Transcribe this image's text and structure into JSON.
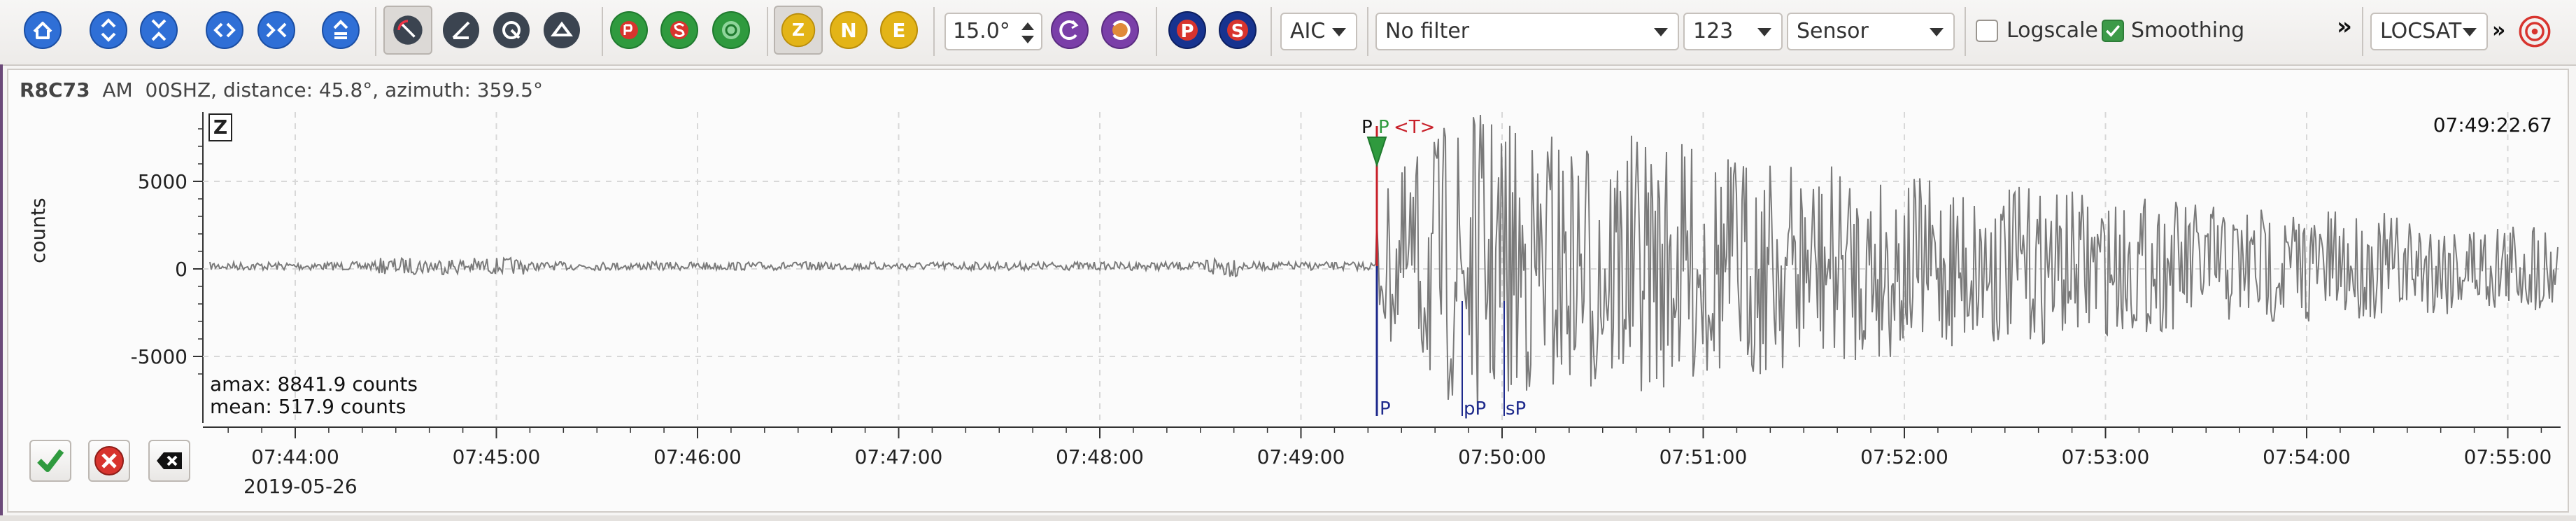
{
  "toolbar": {
    "filter_method": "AIC",
    "angle_value": "15.0°",
    "filter": "No filter",
    "numeric_combo": "123",
    "sensor_combo": "Sensor",
    "logscale_label": "Logscale",
    "logscale_checked": false,
    "smoothing_label": "Smoothing",
    "smoothing_checked": true,
    "overflow_label": "»",
    "locator": "LOCSAT",
    "locator_overflow": "»",
    "components": [
      "Z",
      "N",
      "E"
    ],
    "phase_buttons": [
      "P",
      "S"
    ]
  },
  "trace": {
    "station": "R8C73",
    "network": "AM",
    "channel": "00SHZ",
    "distance_text": "distance: 45.8°",
    "azimuth_text": "azimuth: 359.5°",
    "component": "Z",
    "ylabel": "counts",
    "amax": "amax: 8841.9 counts",
    "mean": "mean: 517.9 counts",
    "time_corner": "07:49:22.67",
    "date": "2019-05-26",
    "y_ticks": [
      "5000",
      "0",
      "-5000"
    ],
    "x_ticks": [
      "07:44:00",
      "07:45:00",
      "07:46:00",
      "07:47:00",
      "07:48:00",
      "07:49:00",
      "07:50:00",
      "07:51:00",
      "07:52:00",
      "07:53:00",
      "07:54:00",
      "07:55:00"
    ],
    "pick_labels_top": [
      "P",
      "P",
      "<T>"
    ],
    "theoretical_phases": [
      "P",
      "pP",
      "sP"
    ]
  },
  "actions": {
    "accept": "accept-pick",
    "reject": "reject-pick",
    "clear": "clear-picks"
  },
  "colors": {
    "accent_green": "#3c9a48",
    "pick_red": "#c8202a",
    "theory_blue": "#1e2a8c",
    "trace_grey": "#7a7a7a",
    "button_blue": "#2f6fd6"
  }
}
